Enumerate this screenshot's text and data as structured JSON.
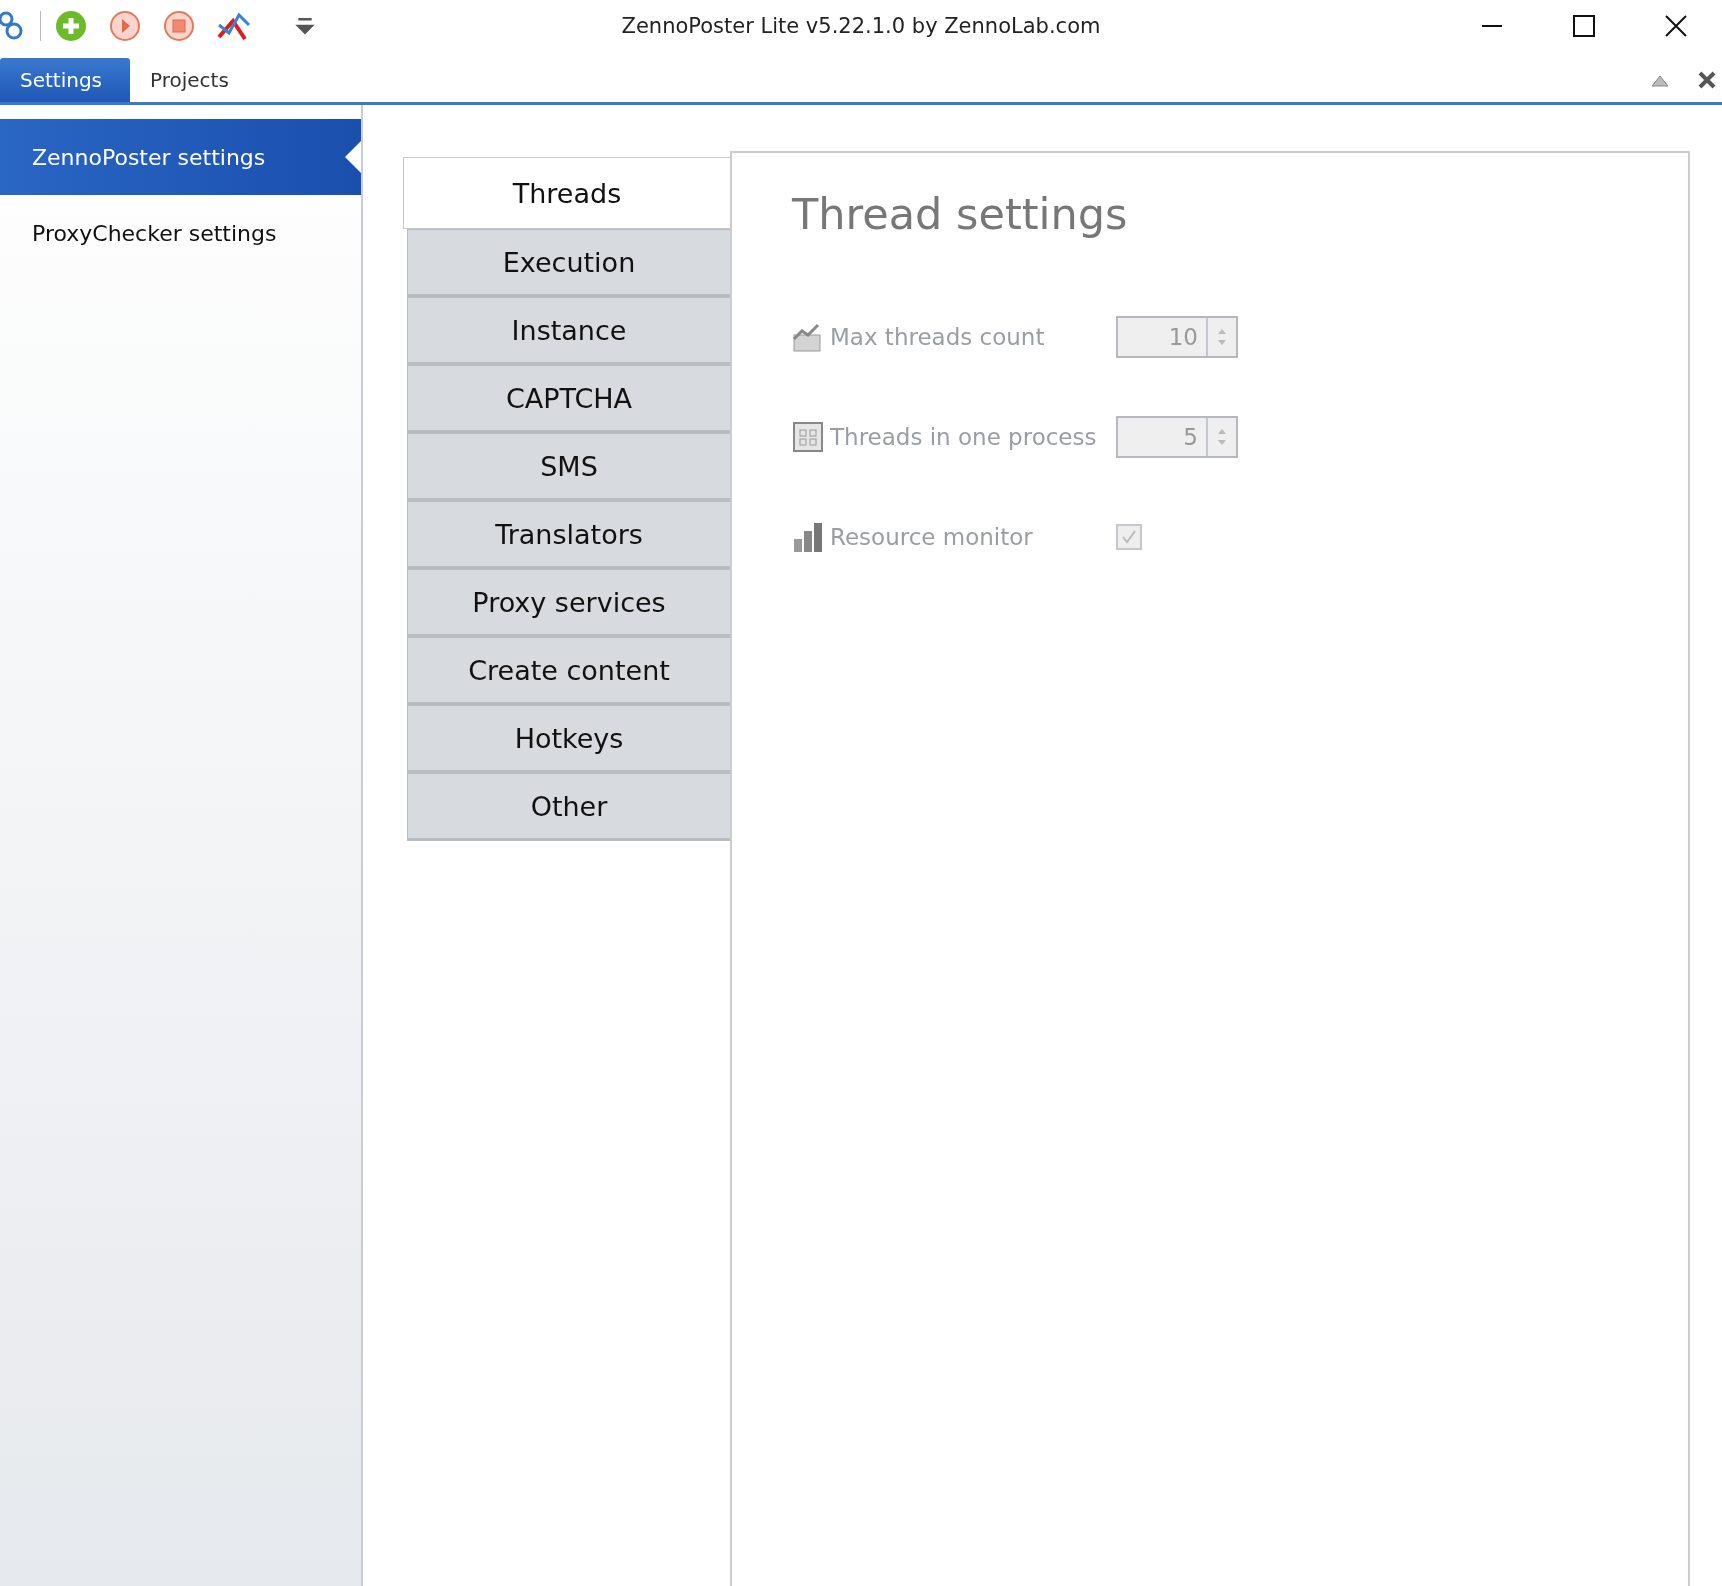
{
  "window": {
    "title": "ZennoPoster Lite v5.22.1.0 by ZennoLab.com"
  },
  "ribbon_tabs": [
    {
      "label": "Settings",
      "selected": true
    },
    {
      "label": "Projects",
      "selected": false
    }
  ],
  "sidebar": {
    "items": [
      {
        "label": "ZennoPoster settings",
        "selected": true
      },
      {
        "label": "ProxyChecker settings",
        "selected": false
      }
    ]
  },
  "settings_tabs": [
    {
      "label": "Threads",
      "selected": true
    },
    {
      "label": "Execution",
      "selected": false
    },
    {
      "label": "Instance",
      "selected": false
    },
    {
      "label": "CAPTCHA",
      "selected": false
    },
    {
      "label": "SMS",
      "selected": false
    },
    {
      "label": "Translators",
      "selected": false
    },
    {
      "label": "Proxy services",
      "selected": false
    },
    {
      "label": "Create content",
      "selected": false
    },
    {
      "label": "Hotkeys",
      "selected": false
    },
    {
      "label": "Other",
      "selected": false
    }
  ],
  "panel": {
    "title": "Thread settings",
    "fields": [
      {
        "kind": "spin",
        "label": "Max threads count",
        "value": "10",
        "disabled": true
      },
      {
        "kind": "spin",
        "label": "Threads in one process",
        "value": "5",
        "disabled": true
      },
      {
        "kind": "checkbox",
        "label": "Resource monitor",
        "checked": true,
        "disabled": true
      }
    ]
  }
}
